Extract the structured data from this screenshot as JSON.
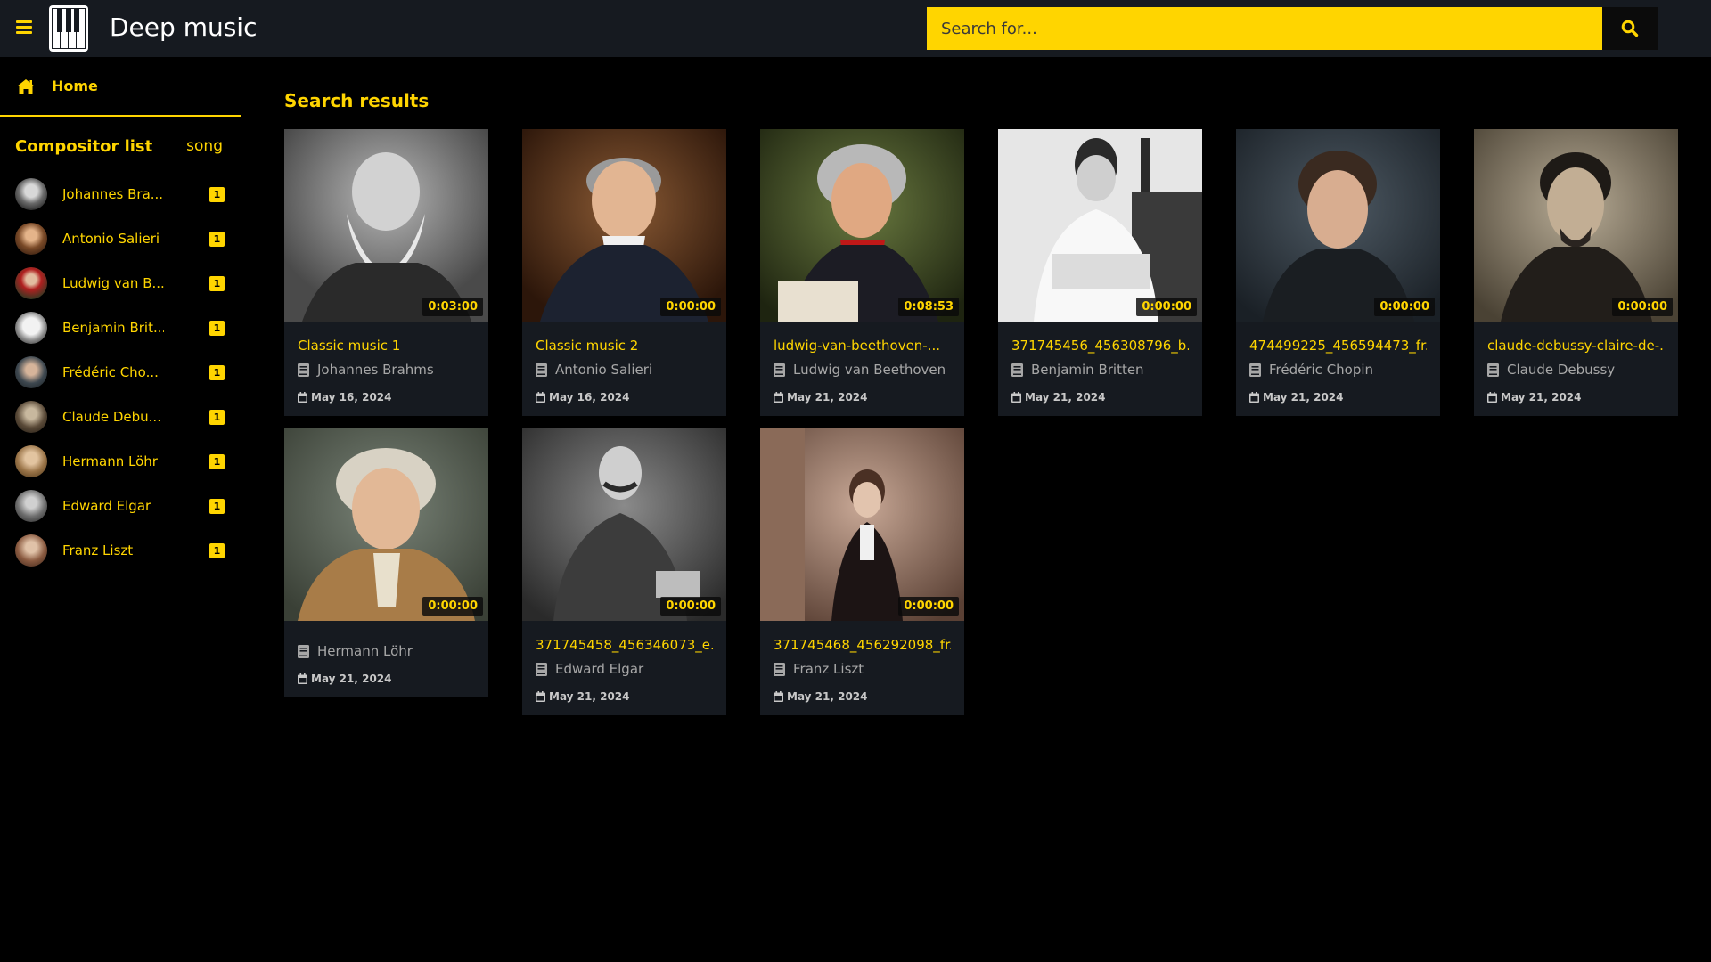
{
  "header": {
    "brand": "Deep music",
    "search_placeholder": "Search for..."
  },
  "sidebar": {
    "home_label": "Home",
    "list_title": "Compositor list",
    "list_count_label": "song",
    "composers": [
      {
        "name": "Johannes Bra...",
        "count": "1"
      },
      {
        "name": "Antonio Salieri",
        "count": "1"
      },
      {
        "name": "Ludwig van B...",
        "count": "1"
      },
      {
        "name": "Benjamin Brit...",
        "count": "1"
      },
      {
        "name": "Frédéric Cho...",
        "count": "1"
      },
      {
        "name": "Claude Debu...",
        "count": "1"
      },
      {
        "name": "Hermann Löhr",
        "count": "1"
      },
      {
        "name": "Edward Elgar",
        "count": "1"
      },
      {
        "name": "Franz Liszt",
        "count": "1"
      }
    ]
  },
  "main": {
    "title": "Search results",
    "cards": [
      {
        "title": "Classic music 1",
        "artist": "Johannes Brahms",
        "date": "May 16, 2024",
        "duration": "0:03:00"
      },
      {
        "title": "Classic music 2",
        "artist": "Antonio Salieri",
        "date": "May 16, 2024",
        "duration": "0:00:00"
      },
      {
        "title": "ludwig-van-beethoven-...",
        "artist": "Ludwig van Beethoven",
        "date": "May 21, 2024",
        "duration": "0:08:53"
      },
      {
        "title": "371745456_456308796_b...",
        "artist": "Benjamin Britten",
        "date": "May 21, 2024",
        "duration": "0:00:00"
      },
      {
        "title": "474499225_456594473_fr...",
        "artist": "Frédéric Chopin",
        "date": "May 21, 2024",
        "duration": "0:00:00"
      },
      {
        "title": "claude-debussy-claire-de-...",
        "artist": "Claude Debussy",
        "date": "May 21, 2024",
        "duration": "0:00:00"
      },
      {
        "title": "",
        "artist": "Hermann Löhr",
        "date": "May 21, 2024",
        "duration": "0:00:00"
      },
      {
        "title": "371745458_456346073_e...",
        "artist": "Edward Elgar",
        "date": "May 21, 2024",
        "duration": "0:00:00"
      },
      {
        "title": "371745468_456292098_fr...",
        "artist": "Franz Liszt",
        "date": "May 21, 2024",
        "duration": "0:00:00"
      }
    ]
  },
  "colors": {
    "accent": "#ffd500",
    "topbar": "#161a20",
    "card": "#161a20",
    "background": "#000000"
  }
}
